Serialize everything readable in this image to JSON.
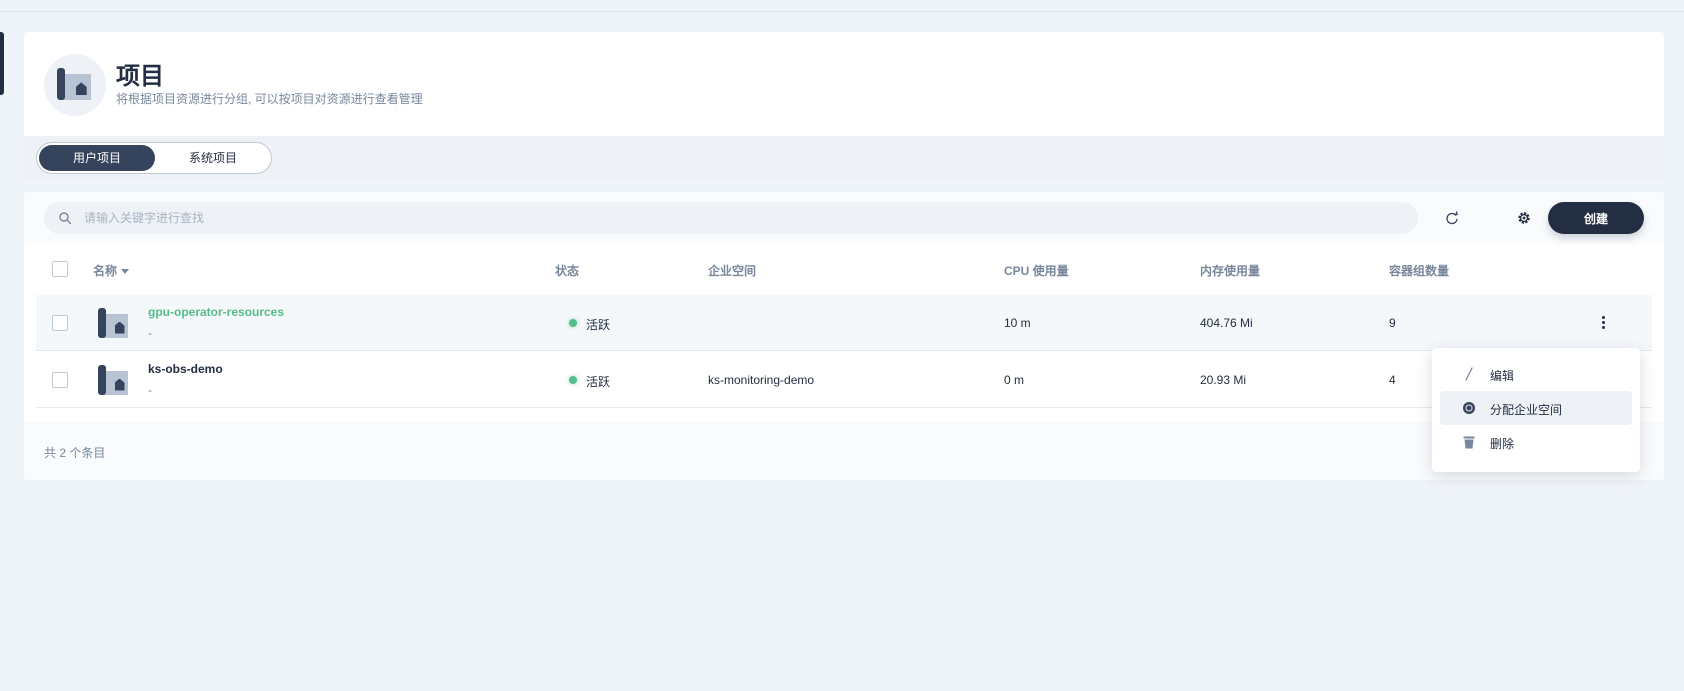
{
  "header": {
    "title": "项目",
    "description": "将根据项目资源进行分组, 可以按项目对资源进行查看管理"
  },
  "tabs": [
    {
      "label": "用户项目",
      "active": true
    },
    {
      "label": "系统项目",
      "active": false
    }
  ],
  "toolbar": {
    "search_placeholder": "请输入关键字进行查找",
    "create_label": "创建"
  },
  "table": {
    "columns": [
      "名称",
      "状态",
      "企业空间",
      "CPU 使用量",
      "内存使用量",
      "容器组数量"
    ],
    "rows": [
      {
        "name": "gpu-operator-resources",
        "sub": "-",
        "status": "活跃",
        "workspace": "",
        "cpu": "10 m",
        "memory": "404.76 Mi",
        "pods": "9"
      },
      {
        "name": "ks-obs-demo",
        "sub": "-",
        "status": "活跃",
        "workspace": "ks-monitoring-demo",
        "cpu": "0 m",
        "memory": "20.93 Mi",
        "pods": "4"
      }
    ]
  },
  "footer": {
    "total": "共 2 个条目"
  },
  "menu": {
    "items": [
      {
        "label": "编辑",
        "icon": "pen-icon"
      },
      {
        "label": "分配企业空间",
        "icon": "workspace-icon"
      },
      {
        "label": "删除",
        "icon": "trash-icon"
      }
    ]
  },
  "colors": {
    "primary_dark": "#242e42",
    "accent_green": "#55bc8a",
    "muted_text": "#79879c",
    "background": "#eff4f9"
  }
}
